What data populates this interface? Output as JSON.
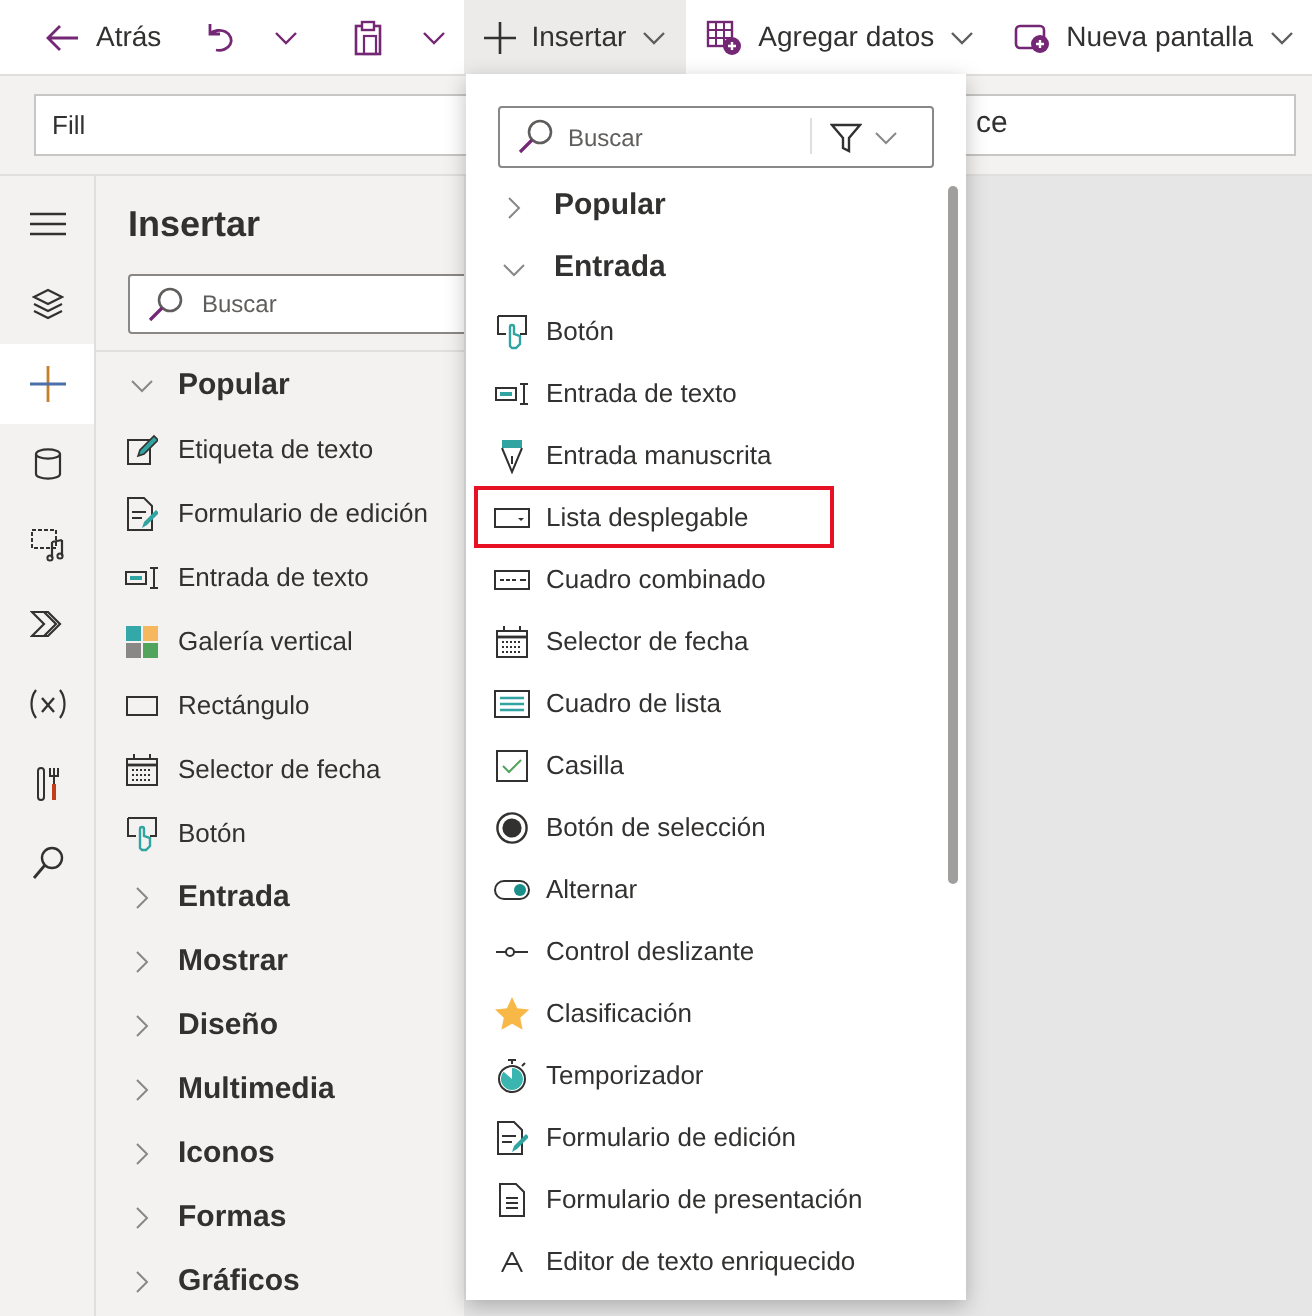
{
  "toolbar": {
    "back": {
      "label": "Atrás"
    },
    "buttons": [
      {
        "label": "Insertar",
        "selected": true
      },
      {
        "label": "Agregar datos",
        "selected": false
      },
      {
        "label": "Nueva pantalla",
        "selected": false
      }
    ]
  },
  "formula_bar": {
    "property": "Fill",
    "formula": "ce"
  },
  "rail": {
    "items": [
      {
        "selected": false
      },
      {
        "selected": false
      },
      {
        "selected": true
      },
      {
        "selected": false
      },
      {
        "selected": false
      },
      {
        "selected": false
      },
      {
        "selected": false
      },
      {
        "selected": false
      },
      {
        "selected": false
      }
    ]
  },
  "insert_panel": {
    "title": "Insertar",
    "search": {
      "placeholder": "Buscar"
    },
    "sections": [
      {
        "label": "Popular",
        "expanded": true,
        "items": [
          "Etiqueta de texto",
          "Formulario de edición",
          "Entrada de texto",
          "Galería vertical",
          "Rectángulo",
          "Selector de fecha",
          "Botón"
        ]
      },
      {
        "label": "Entrada",
        "expanded": false
      },
      {
        "label": "Mostrar",
        "expanded": false
      },
      {
        "label": "Diseño",
        "expanded": false
      },
      {
        "label": "Multimedia",
        "expanded": false
      },
      {
        "label": "Iconos",
        "expanded": false
      },
      {
        "label": "Formas",
        "expanded": false
      },
      {
        "label": "Gráficos",
        "expanded": false
      }
    ]
  },
  "insert_menu": {
    "search": {
      "placeholder": "Buscar"
    },
    "sections": [
      {
        "label": "Popular",
        "expanded": false
      },
      {
        "label": "Entrada",
        "expanded": true,
        "items": [
          {
            "label": "Botón",
            "highlighted": false
          },
          {
            "label": "Entrada de texto",
            "highlighted": false
          },
          {
            "label": "Entrada manuscrita",
            "highlighted": false
          },
          {
            "label": "Lista desplegable",
            "highlighted": true
          },
          {
            "label": "Cuadro combinado",
            "highlighted": false
          },
          {
            "label": "Selector de fecha",
            "highlighted": false
          },
          {
            "label": "Cuadro de lista",
            "highlighted": false
          },
          {
            "label": "Casilla",
            "highlighted": false
          },
          {
            "label": "Botón de selección",
            "highlighted": false
          },
          {
            "label": "Alternar",
            "highlighted": false
          },
          {
            "label": "Control deslizante",
            "highlighted": false
          },
          {
            "label": "Clasificación",
            "highlighted": false
          },
          {
            "label": "Temporizador",
            "highlighted": false
          },
          {
            "label": "Formulario de edición",
            "highlighted": false
          },
          {
            "label": "Formulario de presentación",
            "highlighted": false
          },
          {
            "label": "Editor de texto enriquecido",
            "highlighted": false
          }
        ]
      }
    ]
  }
}
